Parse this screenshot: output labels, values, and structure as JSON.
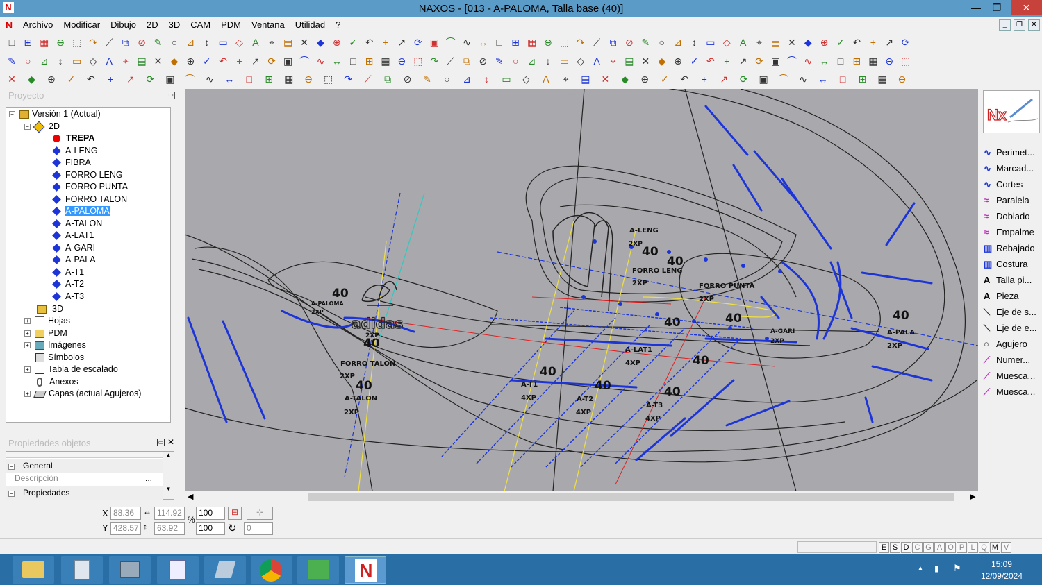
{
  "window": {
    "title": "NAXOS - [013 - A-PALOMA, Talla base (40)]",
    "logo": "N",
    "minimize": "—",
    "maximize": "❐",
    "close": "✕"
  },
  "menubar": {
    "logo": "N",
    "items": [
      "Archivo",
      "Modificar",
      "Dibujo",
      "2D",
      "3D",
      "CAM",
      "PDM",
      "Ventana",
      "Utilidad",
      "?"
    ]
  },
  "mdi": {
    "minimize": "_",
    "restore": "❐",
    "close": "✕"
  },
  "project_panel": {
    "title": "Proyecto"
  },
  "tree": {
    "root": "Versión 1 (Actual)",
    "n2d": "2D",
    "items": [
      "TREPA",
      "A-LENG",
      "FIBRA",
      "FORRO LENG",
      "FORRO PUNTA",
      "FORRO TALON",
      "A-PALOMA",
      "A-TALON",
      "A-LAT1",
      "A-GARI",
      "A-PALA",
      "A-T1",
      "A-T2",
      "A-T3"
    ],
    "n3d": "3D",
    "others": [
      "Hojas",
      "PDM",
      "Imágenes",
      "Símbolos",
      "Tabla de escalado",
      "Anexos",
      "Capas (actual Agujeros)"
    ]
  },
  "props_panel": {
    "title": "Propiedades objetos",
    "general": "General",
    "descripcion": "Descripción",
    "propiedades": "Propiedades",
    "dots": "..."
  },
  "right_tools": [
    "Perimet...",
    "Marcad...",
    "Cortes",
    "Paralela",
    "Doblado",
    "Empalme",
    "Rebajado",
    "Costura",
    "Talla pi...",
    "Pieza",
    "Eje de s...",
    "Eje de e...",
    "Agujero",
    "Numer...",
    "Muesca...",
    "Muesca..."
  ],
  "canvas_labels": {
    "n40": "40",
    "a_leng": "A-LENG",
    "forro_leng": "FORRO LENG",
    "forro_punta": "FORRO PUNTA",
    "a_paloma": "A-PALOMA",
    "forro_talon": "FORRO TALON",
    "a_talon": "A-TALON",
    "a_gari": "A-GARI",
    "a_pala": "A-PALA",
    "a_lat1": "A-LAT1",
    "a_t1": "A-T1",
    "a_t2": "A-T2",
    "a_t3": "A-T3",
    "x2": "2XP",
    "x4": "4XP",
    "brand": "adidas"
  },
  "coords": {
    "x_label": "X",
    "y_label": "Y",
    "x": "88.36",
    "y": "428.57",
    "w": "114.92",
    "h": "63.92",
    "sx": "100",
    "sy": "100",
    "angle": "0",
    "pct": "%"
  },
  "status_keys": [
    "E",
    "S",
    "D",
    "C",
    "G",
    "A",
    "O",
    "P",
    "L",
    "Q",
    "M",
    "V"
  ],
  "clock": {
    "time": "15:09",
    "date": "12/09/2024"
  },
  "colors": {
    "titlebar": "#5b9bc7",
    "canvas": "#a9a9ad",
    "pattern_blue": "#1d35d6",
    "taskbar": "#2a6ea6"
  }
}
